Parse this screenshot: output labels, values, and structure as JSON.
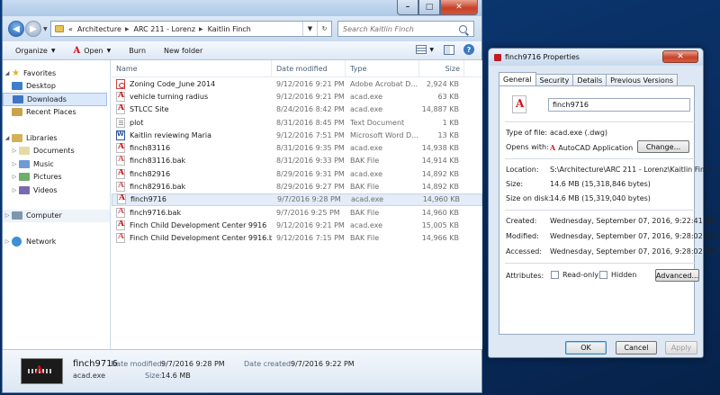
{
  "explorer": {
    "address": {
      "prefix": "«",
      "crumbs": [
        "Architecture",
        "ARC 211 - Lorenz",
        "Kaitlin Finch"
      ]
    },
    "search_placeholder": "Search Kaitlin Finch",
    "toolbar": {
      "organize": "Organize",
      "open": "Open",
      "burn": "Burn",
      "new_folder": "New folder"
    },
    "nav": {
      "favorites": "Favorites",
      "desktop": "Desktop",
      "downloads": "Downloads",
      "recent": "Recent Places",
      "libraries": "Libraries",
      "documents": "Documents",
      "music": "Music",
      "pictures": "Pictures",
      "videos": "Videos",
      "computer": "Computer",
      "network": "Network"
    },
    "columns": {
      "name": "Name",
      "date": "Date modified",
      "type": "Type",
      "size": "Size"
    },
    "files": [
      {
        "name": "Zoning Code_June 2014",
        "date": "9/12/2016 9:21 PM",
        "type": "Adobe Acrobat D...",
        "size": "2,924 KB",
        "icon": "pdf"
      },
      {
        "name": "vehicle turning radius",
        "date": "9/12/2016 9:21 PM",
        "type": "acad.exe",
        "size": "63 KB",
        "icon": "acad"
      },
      {
        "name": "STLCC Site",
        "date": "8/24/2016 8:42 PM",
        "type": "acad.exe",
        "size": "14,887 KB",
        "icon": "acad"
      },
      {
        "name": "plot",
        "date": "8/31/2016 8:45 PM",
        "type": "Text Document",
        "size": "1 KB",
        "icon": "txt"
      },
      {
        "name": "Kaitlin reviewing Maria",
        "date": "9/12/2016 7:51 PM",
        "type": "Microsoft Word D...",
        "size": "13 KB",
        "icon": "doc"
      },
      {
        "name": "finch83116",
        "date": "8/31/2016 9:35 PM",
        "type": "acad.exe",
        "size": "14,938 KB",
        "icon": "acad"
      },
      {
        "name": "finch83116.bak",
        "date": "8/31/2016 9:33 PM",
        "type": "BAK File",
        "size": "14,914 KB",
        "icon": "bak"
      },
      {
        "name": "finch82916",
        "date": "8/29/2016 9:31 PM",
        "type": "acad.exe",
        "size": "14,892 KB",
        "icon": "acad"
      },
      {
        "name": "finch82916.bak",
        "date": "8/29/2016 9:27 PM",
        "type": "BAK File",
        "size": "14,892 KB",
        "icon": "bak"
      },
      {
        "name": "finch9716",
        "date": "9/7/2016 9:28 PM",
        "type": "acad.exe",
        "size": "14,960 KB",
        "icon": "acad",
        "selected": true
      },
      {
        "name": "finch9716.bak",
        "date": "9/7/2016 9:25 PM",
        "type": "BAK File",
        "size": "14,960 KB",
        "icon": "bak"
      },
      {
        "name": "Finch Child Development Center 9916",
        "date": "9/12/2016 9:21 PM",
        "type": "acad.exe",
        "size": "15,005 KB",
        "icon": "acad"
      },
      {
        "name": "Finch Child Development Center 9916.bak",
        "date": "9/12/2016 7:15 PM",
        "type": "BAK File",
        "size": "14,966 KB",
        "icon": "bak"
      }
    ],
    "details": {
      "name": "finch9716",
      "type": "acad.exe",
      "date_modified_label": "Date modified:",
      "date_modified": "9/7/2016 9:28 PM",
      "size_label": "Size:",
      "size": "14.6 MB",
      "date_created_label": "Date created:",
      "date_created": "9/7/2016 9:22 PM"
    }
  },
  "properties": {
    "title": "finch9716 Properties",
    "tabs": [
      "General",
      "Security",
      "Details",
      "Previous Versions"
    ],
    "file_name": "finch9716",
    "type_label": "Type of file:",
    "type_value": "acad.exe (.dwg)",
    "opens_label": "Opens with:",
    "opens_value": "AutoCAD Application",
    "change_button": "Change...",
    "location_label": "Location:",
    "location_value": "S:\\Architecture\\ARC 211 - Lorenz\\Kaitlin Finch",
    "size_label": "Size:",
    "size_value": "14.6 MB (15,318,846 bytes)",
    "disk_label": "Size on disk:",
    "disk_value": "14.6 MB (15,319,040 bytes)",
    "created_label": "Created:",
    "created_value": "Wednesday, September 07, 2016, 9:22:41 PM",
    "modified_label": "Modified:",
    "modified_value": "Wednesday, September 07, 2016, 9:28:02 PM",
    "accessed_label": "Accessed:",
    "accessed_value": "Wednesday, September 07, 2016, 9:28:02 PM",
    "attributes_label": "Attributes:",
    "readonly_label": "Read-only",
    "hidden_label": "Hidden",
    "advanced_button": "Advanced...",
    "ok": "OK",
    "cancel": "Cancel",
    "apply": "Apply"
  }
}
